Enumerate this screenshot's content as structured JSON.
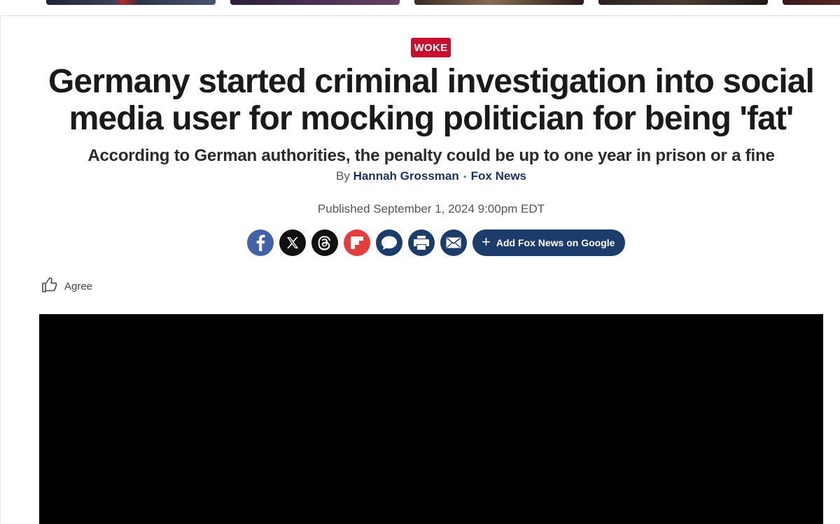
{
  "article": {
    "category": "WOKE",
    "headline_line1": "Germany started criminal investigation into social",
    "headline_line2": "media user for mocking politician for being 'fat'",
    "subheadline": "According to German authorities, the penalty could be up to one year in prison or a fine",
    "byline": {
      "prefix": "By",
      "author": "Hannah Grossman",
      "separator": "•",
      "outlet": "Fox News"
    },
    "published": "Published September 1, 2024 9:00pm EDT"
  },
  "share": {
    "buttons": [
      {
        "name": "facebook-share-button",
        "icon": "facebook-icon",
        "color": "#4361a8"
      },
      {
        "name": "x-share-button",
        "icon": "x-icon",
        "color": "#111111"
      },
      {
        "name": "threads-share-button",
        "icon": "threads-icon",
        "color": "#111111"
      },
      {
        "name": "flipboard-share-button",
        "icon": "flipboard-icon",
        "color": "#e63c3c"
      },
      {
        "name": "comments-button",
        "icon": "comment-icon",
        "color": "#1c3d6b"
      },
      {
        "name": "print-button",
        "icon": "print-icon",
        "color": "#1c3d6b"
      },
      {
        "name": "email-share-button",
        "icon": "email-icon",
        "color": "#1c3d6b"
      }
    ],
    "google_label": "Add Fox News on Google"
  },
  "reaction": {
    "label": "Agree",
    "icon": "thumbs-up-icon"
  },
  "colors": {
    "badge": "#c8102e",
    "navy": "#1c3d6b",
    "link": "#18345c"
  }
}
